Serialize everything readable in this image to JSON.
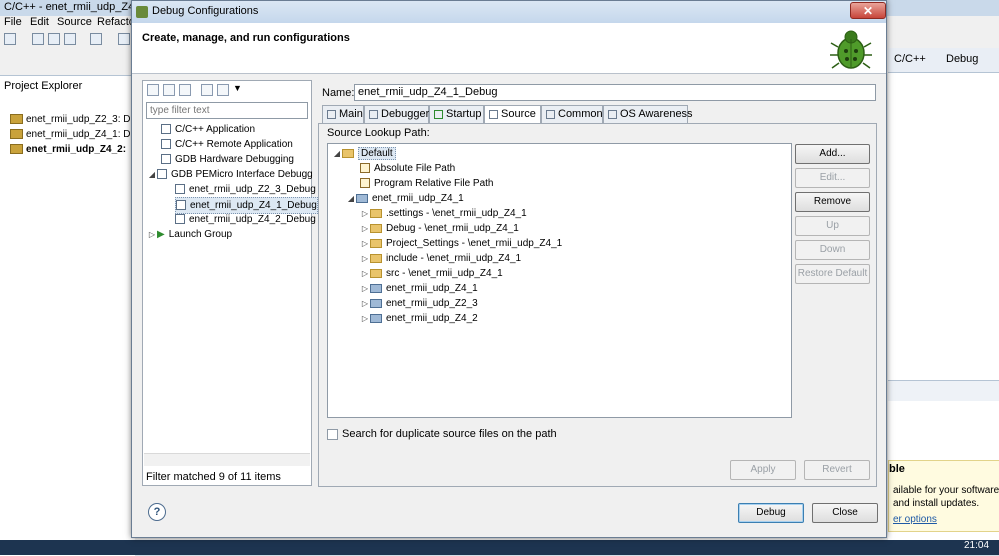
{
  "ide": {
    "title": "C/C++ - enet_rmii_udp_Z4",
    "menu": [
      "File",
      "Edit",
      "Source",
      "Refacto"
    ],
    "project_explorer": {
      "tab_label": "Project Explorer",
      "items": [
        "enet_rmii_udp_Z2_3: D",
        "enet_rmii_udp_Z4_1: D",
        "enet_rmii_udp_Z4_2:"
      ]
    },
    "perspectives": {
      "cpp": "C/C++",
      "debug": "Debug"
    },
    "updates": {
      "title": "ble",
      "line1": "ailable for your software",
      "line2": "and install updates.",
      "link": "er options"
    },
    "clock": "21:04"
  },
  "dialog": {
    "title": "Debug Configurations",
    "banner_text": "Create, manage, and run configurations",
    "filter_placeholder": "type filter text",
    "tree": [
      {
        "label": "C/C++ Application",
        "level": 0
      },
      {
        "label": "C/C++ Remote Application",
        "level": 0
      },
      {
        "label": "GDB Hardware Debugging",
        "level": 0
      },
      {
        "label": "GDB PEMicro Interface Debugg",
        "level": 0
      },
      {
        "label": "enet_rmii_udp_Z2_3_Debug",
        "level": 1
      },
      {
        "label": "enet_rmii_udp_Z4_1_Debug",
        "level": 1
      },
      {
        "label": "enet_rmii_udp_Z4_2_Debug",
        "level": 1
      },
      {
        "label": "Launch Group",
        "level": 0
      }
    ],
    "filter_status": "Filter matched 9 of 11 items",
    "name_label": "Name:",
    "name_value": "enet_rmii_udp_Z4_1_Debug",
    "tabs": [
      "Main",
      "Debugger",
      "Startup",
      "Source",
      "Common",
      "OS Awareness"
    ],
    "active_tab": "Source",
    "source_lookup_label": "Source Lookup Path:",
    "source_tree": [
      {
        "label": "Default",
        "twisty": "▲"
      },
      {
        "label": "Absolute File Path",
        "twisty": ""
      },
      {
        "label": "Program Relative File Path",
        "twisty": ""
      },
      {
        "label": "enet_rmii_udp_Z4_1",
        "twisty": "▲"
      },
      {
        "label": ".settings - \\enet_rmii_udp_Z4_1",
        "twisty": "▷"
      },
      {
        "label": "Debug - \\enet_rmii_udp_Z4_1",
        "twisty": "▷"
      },
      {
        "label": "Project_Settings - \\enet_rmii_udp_Z4_1",
        "twisty": "▷"
      },
      {
        "label": "include - \\enet_rmii_udp_Z4_1",
        "twisty": "▷"
      },
      {
        "label": "src - \\enet_rmii_udp_Z4_1",
        "twisty": "▷"
      },
      {
        "label": "enet_rmii_udp_Z4_1",
        "twisty": "▷"
      },
      {
        "label": "enet_rmii_udp_Z2_3",
        "twisty": "▷"
      },
      {
        "label": "enet_rmii_udp_Z4_2",
        "twisty": "▷"
      }
    ],
    "side_buttons": {
      "add": "Add...",
      "edit": "Edit...",
      "remove": "Remove",
      "up": "Up",
      "down": "Down",
      "restore": "Restore Default"
    },
    "search_duplicates": "Search for duplicate source files on the path",
    "apply": "Apply",
    "revert": "Revert",
    "debug": "Debug",
    "close": "Close",
    "help": "?"
  }
}
